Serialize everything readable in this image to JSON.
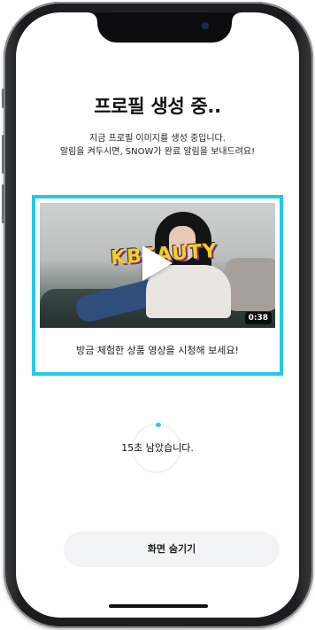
{
  "screen": {
    "title": "프로필 생성 중..",
    "subtitle_line1": "지금 프로필 이미지를 생성 중입니다.",
    "subtitle_line2": "알림을 켜두시면, SNOW가 완료 알림을 보내드려요!"
  },
  "video": {
    "thumbnail_logo_text": "KBEAUTY",
    "duration": "0:38",
    "caption": "방금 체험한 상품 영상을 시청해 보세요!",
    "highlight_color": "#22c9ef"
  },
  "progress": {
    "countdown_text": "15초 남았습니다.",
    "spinner_color": "#34c6ef"
  },
  "actions": {
    "hide_screen_label": "화면 숨기기"
  },
  "icons": {
    "play": "play-icon"
  }
}
